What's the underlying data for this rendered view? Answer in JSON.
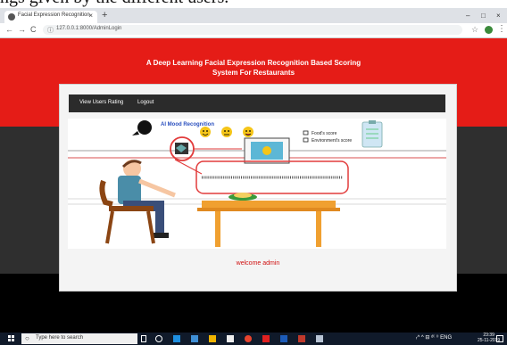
{
  "document": {
    "caption_fragment": "ngs given by the different users."
  },
  "browser": {
    "tab_title": "Facial Expression Recognition",
    "tab_close": "×",
    "new_tab": "+",
    "window_controls": {
      "minimize": "–",
      "restore": "□",
      "close": "×"
    },
    "nav": {
      "back": "←",
      "forward": "→",
      "reload": "C"
    },
    "url_icon": "ⓘ",
    "url": "127.0.0.1:8000/AdminLogin",
    "bookmark_icon": "☆",
    "menu_icon": "⋮"
  },
  "app": {
    "heading_line1": "A Deep Learning Facial Expression Recognition Based Scoring",
    "heading_line2": "System For Restaurants",
    "nav": {
      "view_users_rating": "View Users Rating",
      "logout": "Logout"
    },
    "illustration": {
      "title": "AI Mood Recognition",
      "legend_food": "Food's score",
      "legend_environment": "Environment's score"
    },
    "welcome": "welcome admin"
  },
  "taskbar": {
    "search_icon": "○",
    "search_placeholder": "Type here to search",
    "tray_text": "ᵣ^ ^ ⊟ ᵈ⁽ ⁾⁾ ENG",
    "time": "23:39",
    "date": "25-11-2019"
  },
  "colors": {
    "header_red": "#e51c17",
    "navbar": "#2b2b2b",
    "welcome_text": "#d01010"
  }
}
